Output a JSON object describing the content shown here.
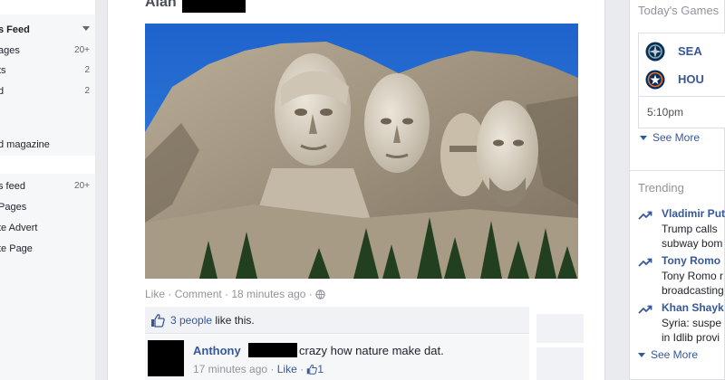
{
  "left_nav": {
    "items": [
      {
        "label": "s Feed",
        "count": ""
      },
      {
        "label": "ages",
        "count": "20+"
      },
      {
        "label": "ts",
        "count": "2"
      },
      {
        "label": "d",
        "count": "2"
      },
      {
        "label": "d magazine",
        "count": ""
      },
      {
        "label": "s feed",
        "count": "20+"
      },
      {
        "label": "Pages",
        "count": ""
      },
      {
        "label": "te Advert",
        "count": ""
      },
      {
        "label": "te Page",
        "count": ""
      }
    ]
  },
  "post": {
    "author": "Alan",
    "photo_alt": "Mount Rushmore",
    "actions": {
      "like": "Like",
      "sep1": " · ",
      "comment": "Comment",
      "sep2": " · ",
      "time": "18 minutes ago",
      "sep3": " · "
    },
    "likes": {
      "count_text": "3 people",
      "suffix": " like this."
    },
    "comment": {
      "name": "Anthony",
      "text": "crazy how nature make dat.",
      "time": "17 minutes ago",
      "sep": " · ",
      "like": "Like",
      "sep2": " · ",
      "like_count": "1"
    }
  },
  "games": {
    "title": "Today's Games",
    "teams": [
      {
        "abbr": "SEA",
        "color": "#0c2c56"
      },
      {
        "abbr": "HOU",
        "color": "#002d62"
      }
    ],
    "time": "5:10pm",
    "see_more": "See More"
  },
  "trending": {
    "title": "Trending",
    "items": [
      {
        "name": "Vladimir Put",
        "desc1": "Trump calls",
        "desc2": "subway bom"
      },
      {
        "name": "Tony Romo",
        "desc1": "Tony Romo r",
        "desc2": "broadcasting"
      },
      {
        "name": "Khan Shayk",
        "desc1": "Syria: suspe",
        "desc2": "in Idlib provi"
      }
    ],
    "see_more": "See More"
  },
  "colors": {
    "link": "#365899",
    "muted": "#90949c",
    "bg": "#e9ebee"
  }
}
